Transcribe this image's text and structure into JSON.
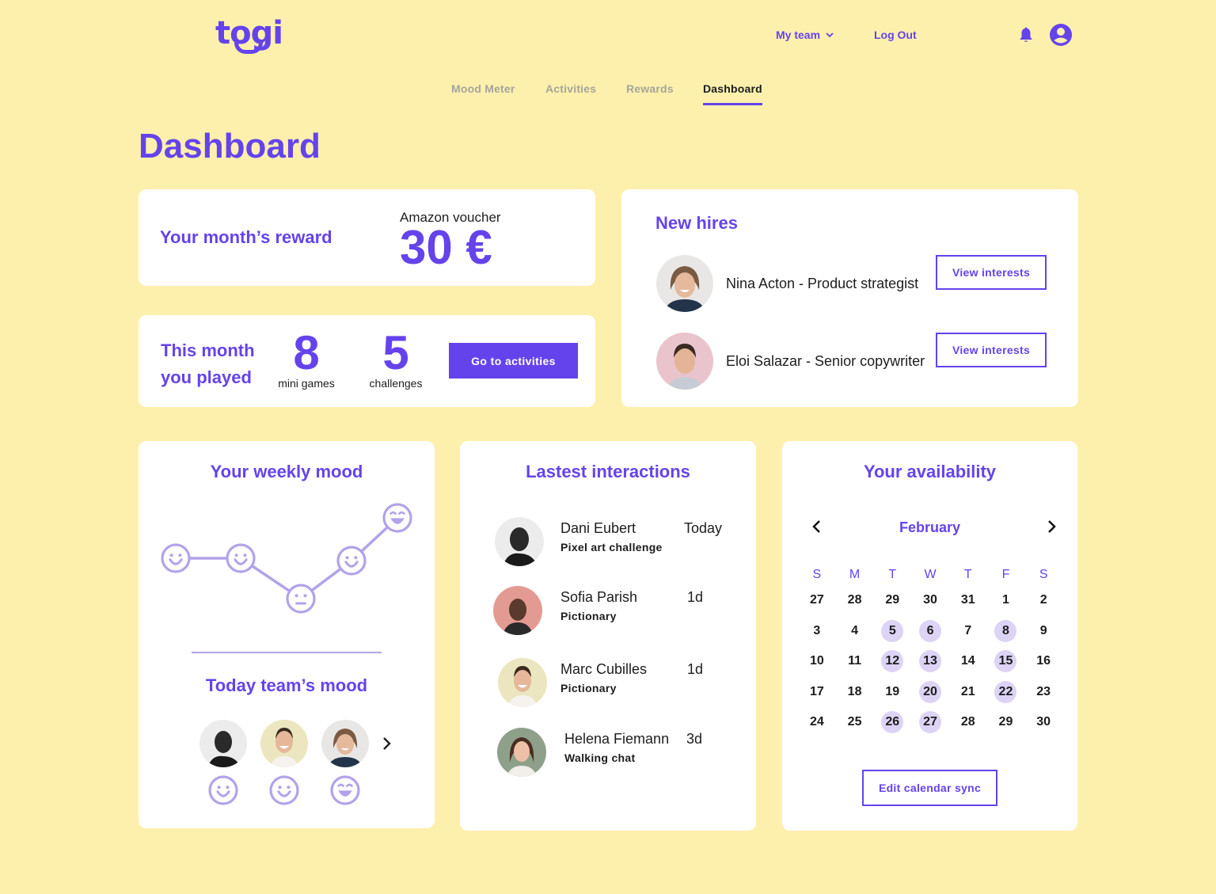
{
  "brand": {
    "name": "togi",
    "accent": "#6543ec",
    "background": "#fdf0ad",
    "highlight": "#dcd3f5"
  },
  "topnav": {
    "team_label": "My team",
    "logout_label": "Log Out",
    "icons": [
      "bell-icon",
      "user-avatar-icon"
    ]
  },
  "tabs": [
    {
      "label": "Mood Meter",
      "active": false
    },
    {
      "label": "Activities",
      "active": false
    },
    {
      "label": "Rewards",
      "active": false
    },
    {
      "label": "Dashboard",
      "active": true
    }
  ],
  "page_title": "Dashboard",
  "reward": {
    "label": "Your month’s reward",
    "voucher": "Amazon voucher",
    "amount": "30 €"
  },
  "played": {
    "label": "This month you played",
    "mini_games_count": "8",
    "mini_games_label": "mini games",
    "challenges_count": "5",
    "challenges_label": "challenges",
    "button_label": "Go to activities"
  },
  "new_hires": {
    "title": "New hires",
    "button_label": "View interests",
    "items": [
      {
        "name": "Nina Acton - Product strategist"
      },
      {
        "name": "Eloi Salazar - Senior copywriter"
      }
    ]
  },
  "weekly_mood": {
    "title": "Your weekly mood",
    "scale": [
      "neutral",
      "happy",
      "very-happy"
    ],
    "values": [
      "happy",
      "happy",
      "neutral",
      "happy",
      "very-happy"
    ]
  },
  "team_mood": {
    "title": "Today team’s mood",
    "members": [
      {
        "mood": "happy"
      },
      {
        "mood": "happy"
      },
      {
        "mood": "very-happy"
      }
    ]
  },
  "interactions": {
    "title": "Lastest interactions",
    "items": [
      {
        "name": "Dani Eubert",
        "activity": "Pixel art challenge",
        "time": "Today"
      },
      {
        "name": "Sofia Parish",
        "activity": "Pictionary",
        "time": "1d"
      },
      {
        "name": "Marc Cubilles",
        "activity": "Pictionary",
        "time": "1d"
      },
      {
        "name": "Helena Fiemann",
        "activity": "Walking chat",
        "time": "3d"
      }
    ]
  },
  "availability": {
    "title": "Your availability",
    "month": "February",
    "weekdays": [
      "S",
      "M",
      "T",
      "W",
      "T",
      "F",
      "S"
    ],
    "weeks": [
      [
        "27",
        "28",
        "29",
        "30",
        "31",
        "1",
        "2"
      ],
      [
        "3",
        "4",
        "5",
        "6",
        "7",
        "8",
        "9"
      ],
      [
        "10",
        "11",
        "12",
        "13",
        "14",
        "15",
        "16"
      ],
      [
        "17",
        "18",
        "19",
        "20",
        "21",
        "22",
        "23"
      ],
      [
        "24",
        "25",
        "26",
        "27",
        "28",
        "29",
        "30"
      ]
    ],
    "available_days": [
      5,
      6,
      8,
      12,
      13,
      15,
      20,
      22,
      26,
      27
    ],
    "button_label": "Edit calendar sync"
  }
}
